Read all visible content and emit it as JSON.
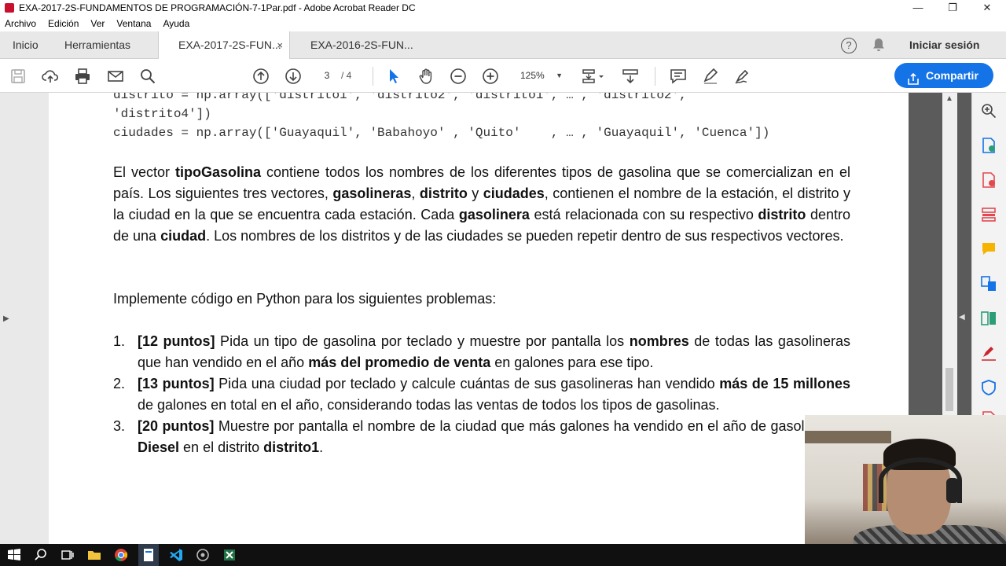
{
  "window": {
    "title": "EXA-2017-2S-FUNDAMENTOS DE PROGRAMACIÓN-7-1Par.pdf - Adobe Acrobat Reader DC",
    "minimize": "—",
    "maximize": "❐",
    "close": "✕"
  },
  "menu": {
    "items": [
      "Archivo",
      "Edición",
      "Ver",
      "Ventana",
      "Ayuda"
    ]
  },
  "tabs": {
    "home": "Inicio",
    "tools": "Herramientas",
    "doc1": "EXA-2017-2S-FUN...",
    "doc1_close": "×",
    "doc2": "EXA-2016-2S-FUN...",
    "help": "?",
    "signin": "Iniciar sesión"
  },
  "toolbar": {
    "page_current": "3",
    "page_total": "/ 4",
    "zoom": "125%",
    "zoom_caret": "▼",
    "share": "Compartir"
  },
  "document": {
    "code_lines": [
      "distrito = np.array(['distrito1', 'distrito2', 'distrito1', … , 'distrito2',",
      "'distrito4'])",
      "ciudades = np.array(['Guayaquil', 'Babahoyo' , 'Quito'    , … , 'Guayaquil', 'Cuenca'])"
    ],
    "p1": [
      {
        "t": "El vector ",
        "b": false
      },
      {
        "t": "tipoGasolina",
        "b": true
      },
      {
        "t": " contiene todos los nombres de los diferentes tipos de gasolina que se comercializan en el país. Los siguientes tres vectores, ",
        "b": false
      },
      {
        "t": "gasolineras",
        "b": true
      },
      {
        "t": ", ",
        "b": false
      },
      {
        "t": "distrito",
        "b": true
      },
      {
        "t": " y ",
        "b": false
      },
      {
        "t": "ciudades",
        "b": true
      },
      {
        "t": ", contienen el nombre de la estación, el distrito y la ciudad en la que se encuentra cada estación. Cada ",
        "b": false
      },
      {
        "t": "gasolinera",
        "b": true
      },
      {
        "t": " está relacionada con su respectivo ",
        "b": false
      },
      {
        "t": "distrito",
        "b": true
      },
      {
        "t": " dentro de una ",
        "b": false
      },
      {
        "t": "ciudad",
        "b": true
      },
      {
        "t": ". Los nombres de los distritos y de las ciudades se pueden repetir dentro de sus respectivos vectores.",
        "b": false
      }
    ],
    "p2": "Implemente código en Python para los siguientes problemas:",
    "items": [
      {
        "num": "1.",
        "segs": [
          {
            "t": "[12 puntos]",
            "b": true
          },
          {
            "t": " Pida un tipo de gasolina por teclado y muestre por pantalla los ",
            "b": false
          },
          {
            "t": "nombres",
            "b": true
          },
          {
            "t": " de todas las gasolineras que han vendido en el año ",
            "b": false
          },
          {
            "t": "más del promedio de venta",
            "b": true
          },
          {
            "t": " en galones para ese tipo.",
            "b": false
          }
        ]
      },
      {
        "num": "2.",
        "segs": [
          {
            "t": "[13 puntos]",
            "b": true
          },
          {
            "t": " Pida una ciudad por teclado y calcule cuántas de sus gasolineras han vendido ",
            "b": false
          },
          {
            "t": "más de 15 millones",
            "b": true
          },
          {
            "t": " de galones en total en el año, considerando todas las ventas de todos los tipos de gasolinas.",
            "b": false
          }
        ]
      },
      {
        "num": "3.",
        "segs": [
          {
            "t": "[20 puntos]",
            "b": true
          },
          {
            "t": " Muestre por pantalla el nombre de la ciudad que más galones ha vendido en el año de",
            "b": false
          },
          {
            "t": " gasolina tipo ",
            "b": false
          },
          {
            "t": "Diesel",
            "b": true
          },
          {
            "t": " en el distrito ",
            "b": false
          },
          {
            "t": "distrito1",
            "b": true
          },
          {
            "t": ".",
            "b": false
          }
        ]
      }
    ]
  },
  "colors": {
    "accent": "#1473e6",
    "acrobat_red": "#c8102e"
  }
}
